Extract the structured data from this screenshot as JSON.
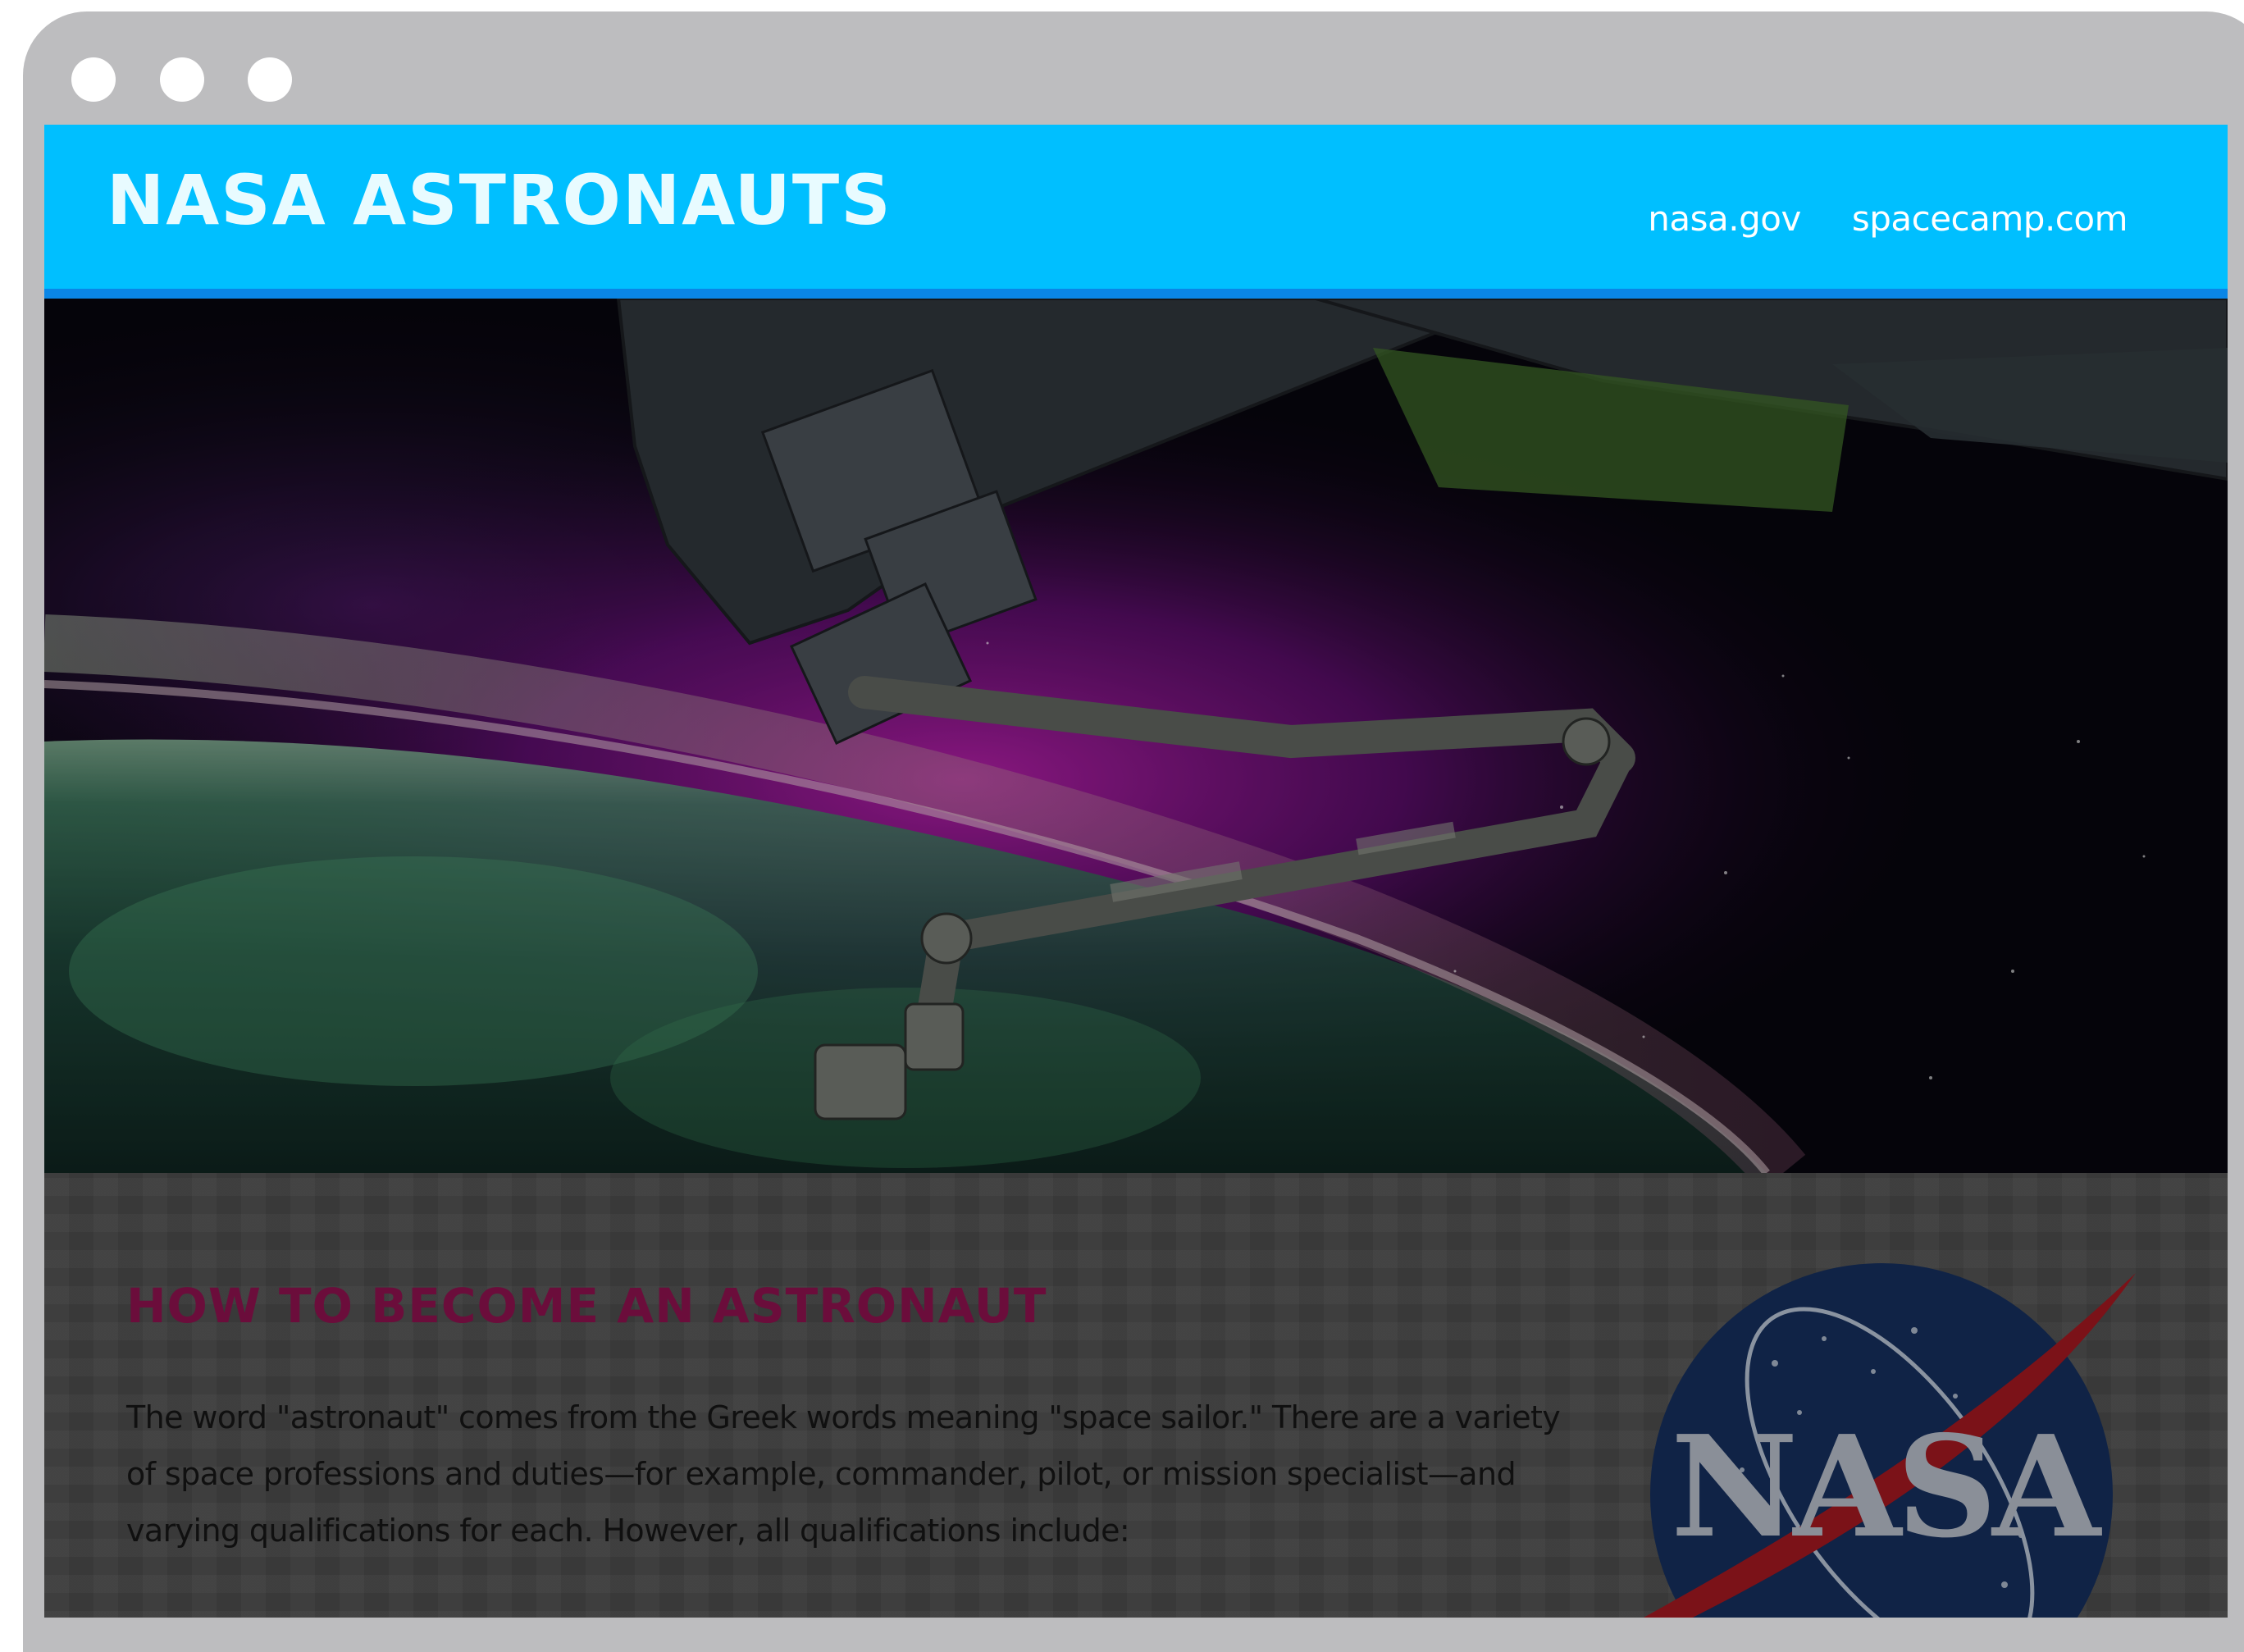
{
  "header": {
    "title": "NASA ASTRONAUTS",
    "nav": [
      {
        "label": "nasa.gov"
      },
      {
        "label": "spacecamp.com"
      }
    ]
  },
  "hero": {
    "image": "space-station-robotic-arm-over-earth-aurora"
  },
  "main": {
    "heading": "HOW TO BECOME AN ASTRONAUT",
    "paragraph": "The word \"astronaut\" comes from the Greek words meaning \"space sailor.\" There are a variety of space professions and duties—for example, commander, pilot, or mission specialist—and varying qualifications for each. However, all qualifications include:",
    "logo": {
      "text": "NASA",
      "icon": "nasa-meatball-logo"
    }
  },
  "colors": {
    "header_bg": "#00bfff",
    "header_border": "#0a86e6",
    "heading": "#6b0d3b",
    "content_bg": "#3b3b3b",
    "browser_frame": "#bdbdbf"
  }
}
